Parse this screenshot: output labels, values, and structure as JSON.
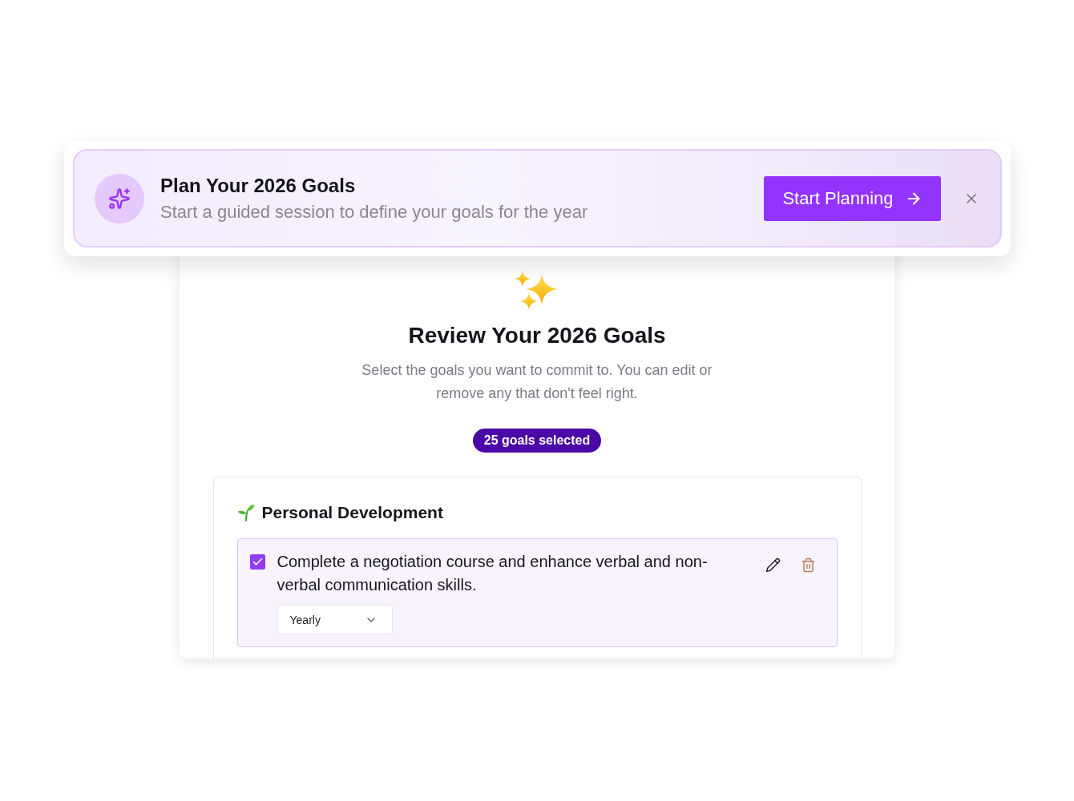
{
  "banner": {
    "title": "Plan Your 2026 Goals",
    "subtitle": "Start a guided session to define your goals for the year",
    "button": "Start Planning"
  },
  "review": {
    "title": "Review Your 2026 Goals",
    "description": "Select the goals you want to commit to. You can edit or remove any that don't feel right.",
    "selected_count": "25 goals selected"
  },
  "sections": [
    {
      "title": "Personal Development",
      "goals": [
        {
          "text": "Complete a negotiation course and enhance verbal and non-verbal communication skills.",
          "checked": true,
          "frequency": "Yearly"
        }
      ]
    }
  ]
}
